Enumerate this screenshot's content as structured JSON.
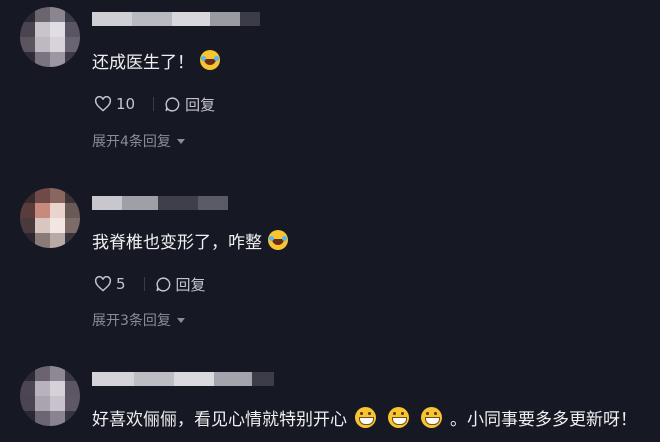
{
  "comments": [
    {
      "text": "还成医生了！",
      "likes": "10",
      "reply_label": "回复",
      "expand_label": "展开4条回复"
    },
    {
      "text": "我脊椎也变形了，咋整",
      "likes": "5",
      "reply_label": "回复",
      "expand_label": "展开3条回复"
    },
    {
      "text_part1": "好喜欢俪俪，看见心情就特别开心",
      "text_part2": "。小同事要多多更新呀！"
    }
  ],
  "icons": {
    "emoji_1": "laughing-tears-emoji",
    "emoji_2": "laughing-tears-emoji",
    "emoji_3": "grinning-emoji",
    "like": "heart-icon",
    "reply": "chat-bubble-icon",
    "expand": "caret-down-icon"
  },
  "colors": {
    "background": "#161823",
    "text": "#f0f0f2",
    "secondary_text": "#8b8c94"
  }
}
